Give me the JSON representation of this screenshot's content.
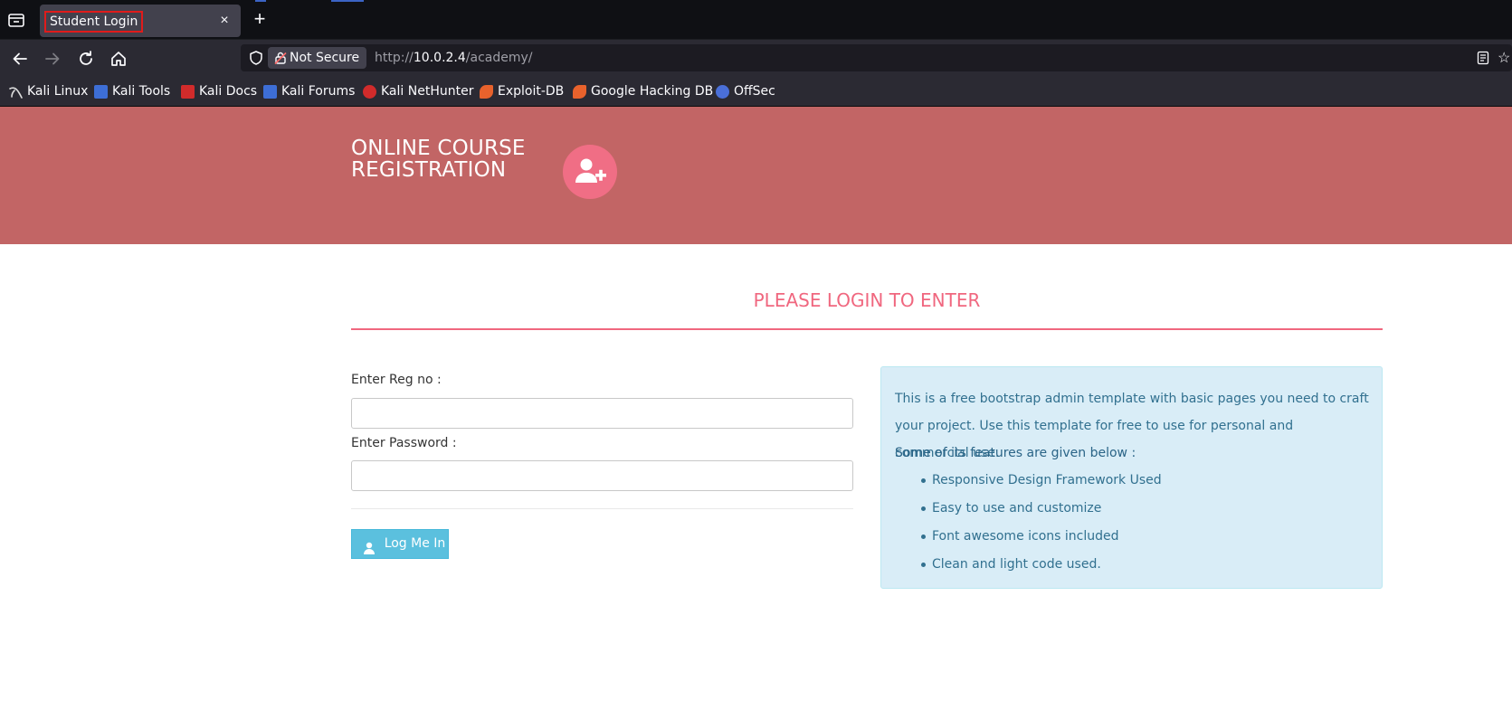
{
  "browser": {
    "tab_title": "Student Login",
    "tab_close": "×",
    "new_tab": "+",
    "not_secure_label": "Not Secure",
    "url_scheme": "http://",
    "url_host": "10.0.2.4",
    "url_path": "/academy/",
    "bookmarks": [
      {
        "label": "Kali Linux",
        "icon": "kali-linux-icon",
        "color": "#2d2d2d"
      },
      {
        "label": "Kali Tools",
        "icon": "kali-tools-icon",
        "color": "#3d6ed6"
      },
      {
        "label": "Kali Docs",
        "icon": "kali-docs-icon",
        "color": "#d12b2b"
      },
      {
        "label": "Kali Forums",
        "icon": "kali-forums-icon",
        "color": "#3d6ed6"
      },
      {
        "label": "Kali NetHunter",
        "icon": "kali-nethunter-icon",
        "color": "#d12b2b"
      },
      {
        "label": "Exploit-DB",
        "icon": "exploit-db-icon",
        "color": "#e8622c"
      },
      {
        "label": "Google Hacking DB",
        "icon": "google-hacking-db-icon",
        "color": "#e8622c"
      },
      {
        "label": "OffSec",
        "icon": "offsec-icon",
        "color": "#4a6fd8"
      }
    ]
  },
  "header": {
    "title_line1": "ONLINE COURSE",
    "title_line2": "REGISTRATION",
    "logo_icon": "user-plus-icon",
    "background": "#c26565",
    "logo_color": "#f06e85"
  },
  "main": {
    "heading": "PLEASE LOGIN TO ENTER",
    "accent": "#f0677f",
    "form": {
      "reg_label": "Enter Reg no :",
      "reg_value": "",
      "password_label": "Enter Password :",
      "password_value": "",
      "submit_label": "Log Me In"
    },
    "info": {
      "text": "This is a free bootstrap admin template with basic pages you need to craft your project. Use this template for free to use for personal and commercial use.",
      "subheading": "Some of its features are given below :",
      "features": [
        "Responsive Design Framework Used",
        "Easy to use and customize",
        "Font awesome icons included",
        "Clean and light code used."
      ]
    }
  }
}
